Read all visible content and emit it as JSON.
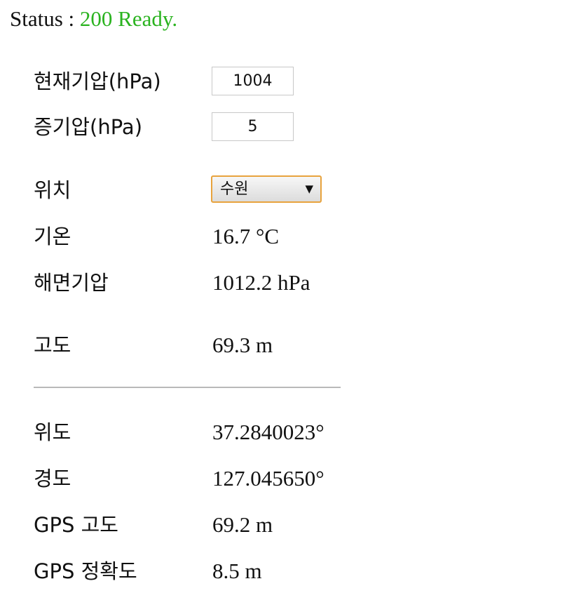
{
  "status": {
    "label": "Status : ",
    "value": "200 Ready."
  },
  "pressure_inputs": {
    "current_pressure_label": "현재기압(hPa)",
    "current_pressure_value": "1004",
    "vapor_pressure_label": "증기압(hPa)",
    "vapor_pressure_value": "5"
  },
  "location": {
    "label": "위치",
    "selected": "수원",
    "arrow": "▼"
  },
  "readings": {
    "temperature_label": "기온",
    "temperature_value": "16.7 °C",
    "sea_level_pressure_label": "해면기압",
    "sea_level_pressure_value": "1012.2 hPa",
    "altitude_label": "고도",
    "altitude_value": "69.3 m"
  },
  "gps": {
    "latitude_label": "위도",
    "latitude_value": "37.2840023°",
    "longitude_label": "경도",
    "longitude_value": "127.045650°",
    "gps_altitude_label": "GPS 고도",
    "gps_altitude_value": "69.2 m",
    "gps_accuracy_label": "GPS 정확도",
    "gps_accuracy_value": "8.5 m"
  },
  "colors": {
    "status_ok": "#2ab31f",
    "select_focus_border": "#e8a33d"
  },
  "icons": {
    "select_arrow": "dropdown-triangle-icon"
  }
}
